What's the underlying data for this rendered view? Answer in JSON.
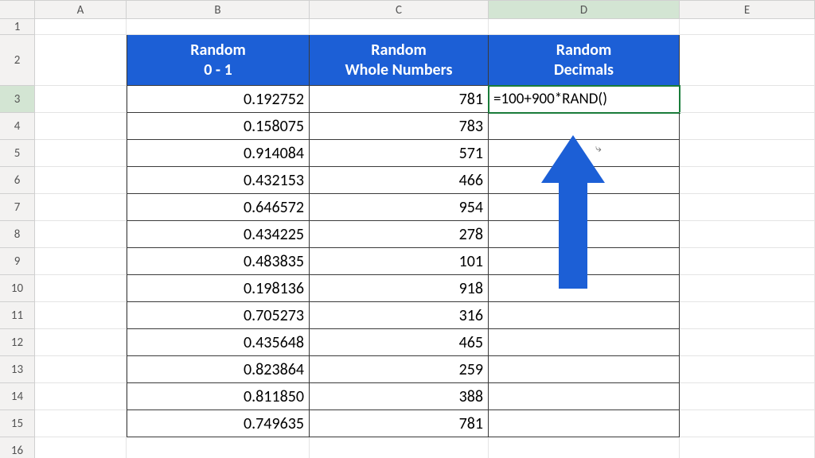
{
  "columns": [
    "A",
    "B",
    "C",
    "D",
    "E"
  ],
  "active_column": "D",
  "active_row": 3,
  "row_count": 16,
  "header_row_height": 64,
  "data_row_height": 34,
  "narrow_row_height": 20,
  "headers": {
    "B": {
      "line1": "Random",
      "line2": "0 - 1"
    },
    "C": {
      "line1": "Random",
      "line2": "Whole Numbers"
    },
    "D": {
      "line1": "Random",
      "line2": "Decimals"
    }
  },
  "formula_cell": {
    "ref": "D3",
    "text": "=100+900*RAND()"
  },
  "data": {
    "B": [
      "0.192752",
      "0.158075",
      "0.914084",
      "0.432153",
      "0.646572",
      "0.434225",
      "0.483835",
      "0.198136",
      "0.705273",
      "0.435648",
      "0.823864",
      "0.811850",
      "0.749635"
    ],
    "C": [
      "781",
      "783",
      "571",
      "466",
      "954",
      "278",
      "101",
      "918",
      "316",
      "465",
      "259",
      "388",
      "781"
    ]
  },
  "cursor_glyph": "↵",
  "chart_data": {
    "type": "table",
    "columns": [
      "Random 0 - 1",
      "Random Whole Numbers",
      "Random Decimals"
    ],
    "rows": [
      [
        0.192752,
        781,
        "=100+900*RAND()"
      ],
      [
        0.158075,
        783,
        null
      ],
      [
        0.914084,
        571,
        null
      ],
      [
        0.432153,
        466,
        null
      ],
      [
        0.646572,
        954,
        null
      ],
      [
        0.434225,
        278,
        null
      ],
      [
        0.483835,
        101,
        null
      ],
      [
        0.198136,
        918,
        null
      ],
      [
        0.705273,
        316,
        null
      ],
      [
        0.435648,
        465,
        null
      ],
      [
        0.823864,
        259,
        null
      ],
      [
        0.81185,
        388,
        null
      ],
      [
        0.749635,
        781,
        null
      ]
    ]
  }
}
